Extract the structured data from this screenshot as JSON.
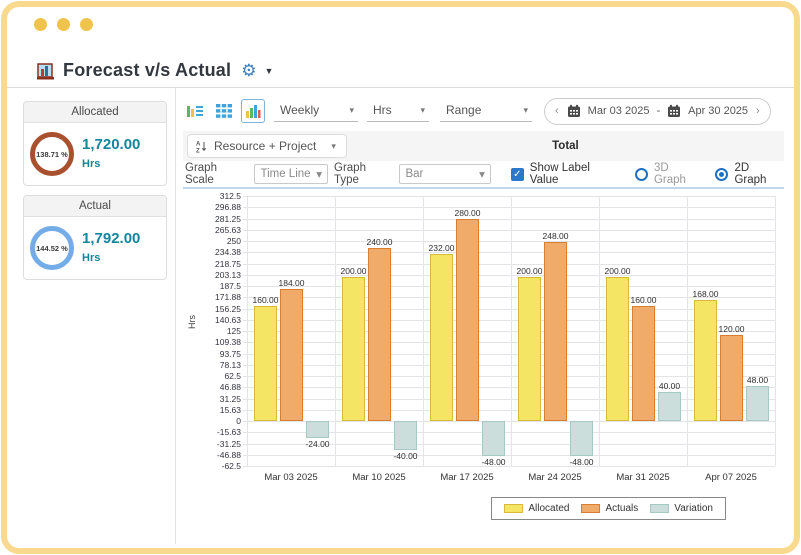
{
  "window": {
    "title": "Forecast v/s Actual"
  },
  "sidebar": {
    "cards": [
      {
        "header": "Allocated",
        "percent": "138.71 %",
        "value": "1,720.00",
        "unit": "Hrs",
        "ring_color": "#A9512E"
      },
      {
        "header": "Actual",
        "percent": "144.52 %",
        "value": "1,792.00",
        "unit": "Hrs",
        "ring_color": "#74ACE8"
      }
    ]
  },
  "toolbar": {
    "period_select": "Weekly",
    "unit_select": "Hrs",
    "range_select": "Range",
    "date_range": {
      "prev": "‹",
      "start": "Mar 03 2025",
      "separator": "-",
      "end": "Apr 30 2025",
      "next": "›"
    }
  },
  "grouping_bar": {
    "button_label": "Resource + Project",
    "column_header": "Total"
  },
  "graph_controls": {
    "scale_label": "Graph Scale",
    "scale_value": "Time Line",
    "type_label": "Graph Type",
    "type_value": "Bar",
    "show_label_value": {
      "label": "Show Label Value",
      "checked": true
    },
    "graph_3d": {
      "label": "3D Graph",
      "selected": false
    },
    "graph_2d": {
      "label": "2D Graph",
      "selected": true
    }
  },
  "chart_data": {
    "type": "bar",
    "title": "",
    "xlabel": "",
    "ylabel": "Hrs",
    "categories": [
      "Mar 03 2025",
      "Mar 10 2025",
      "Mar 17 2025",
      "Mar 24 2025",
      "Mar 31 2025",
      "Apr 07 2025"
    ],
    "series": [
      {
        "name": "Allocated",
        "color": "#F5E565",
        "border": "#D9B93C",
        "values": [
          160,
          200,
          232,
          200,
          200,
          168
        ],
        "labels": [
          "160.00",
          "200.00",
          "232.00",
          "200.00",
          "200.00",
          "168.00"
        ]
      },
      {
        "name": "Actuals",
        "color": "#F0AA6A",
        "border": "#D97E2E",
        "values": [
          184,
          240,
          280,
          248,
          160,
          120
        ],
        "labels": [
          "184.00",
          "240.00",
          "280.00",
          "248.00",
          "160.00",
          "120.00"
        ]
      },
      {
        "name": "Variation",
        "color": "#CCDEDB",
        "border": "#A8C8C4",
        "values": [
          -24,
          -40,
          -48,
          -48,
          40,
          48
        ],
        "labels": [
          "-24.00",
          "-40.00",
          "-48.00",
          "-48.00",
          "40.00",
          "48.00"
        ]
      }
    ],
    "ylim": [
      -62.5,
      312.5
    ],
    "ytick_step": 15.625,
    "yticks": [
      "312.5",
      "296.88",
      "281.25",
      "265.63",
      "250",
      "234.38",
      "218.75",
      "203.13",
      "187.5",
      "171.88",
      "156.25",
      "140.63",
      "125",
      "109.38",
      "93.75",
      "78.13",
      "62.5",
      "46.88",
      "31.25",
      "15.63",
      "0",
      "-15.63",
      "-31.25",
      "-46.88",
      "-62.5"
    ],
    "grid": true,
    "value_labels": true,
    "legend_position": "bottom-right"
  }
}
